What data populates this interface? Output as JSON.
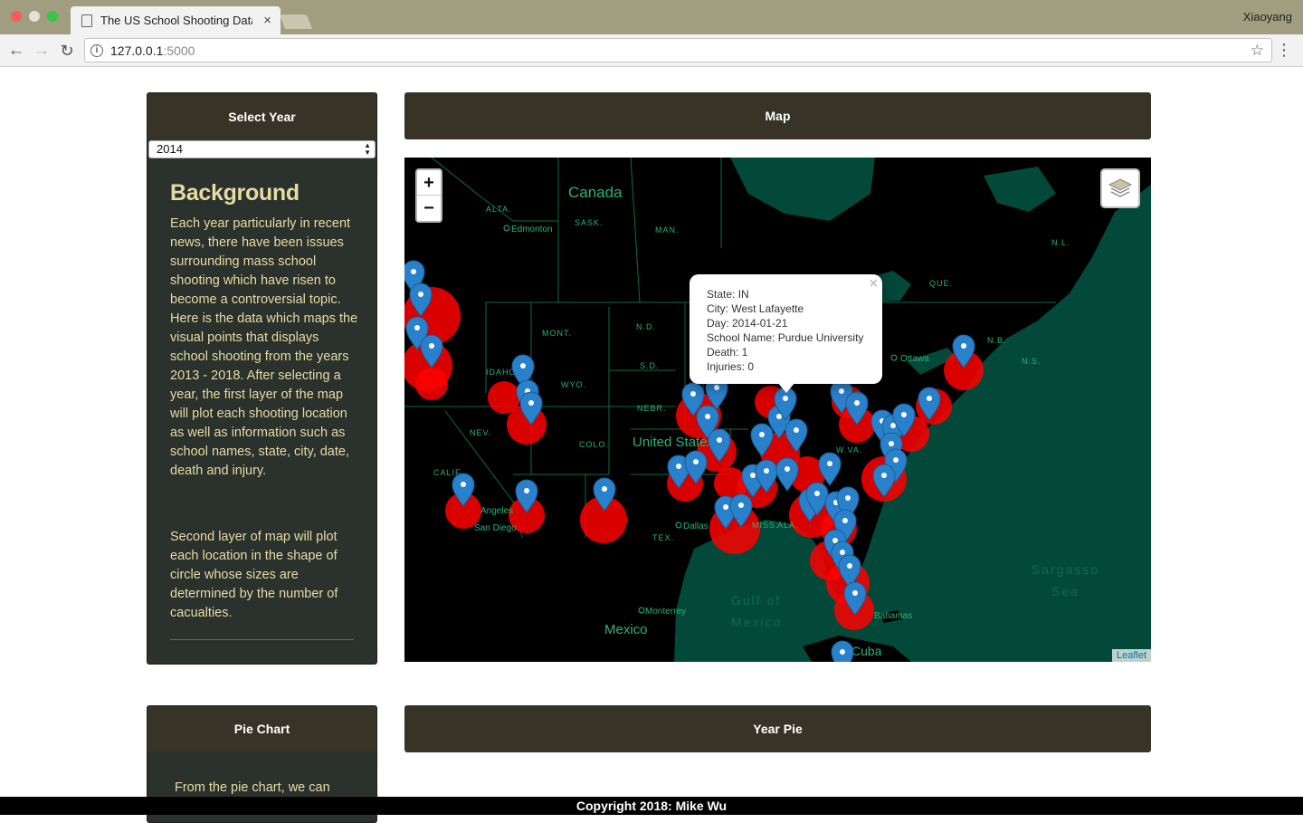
{
  "browser": {
    "tab_title": "The US School Shooting Data",
    "tab_close": "×",
    "profile_name": "Xiaoyang",
    "url_host": "127.0.0.1",
    "url_port": ":5000"
  },
  "sidebar": {
    "header": "Select Year",
    "selected_year": "2014",
    "background_title": "Background",
    "background_para1": "Each year particularly in recent news, there have been issues surrounding mass school shooting which have risen to become a controversial topic. Here is the data which maps the visual points that displays school shooting from the years 2013 - 2018. After selecting a year, the first layer of the map will plot each shooting location as well as information such as school names, state, city, date, death and injury.",
    "background_para2": "Second layer of map will plot each location in the shape of circle whose sizes are determined by the number of cacualties."
  },
  "map_panel": {
    "header": "Map",
    "zoom_in": "+",
    "zoom_out": "−",
    "attribution": "Leaflet",
    "labels": {
      "canada": "Canada",
      "alta": "ALTA.",
      "sask": "SASK.",
      "man": "MAN.",
      "edmonton": "Edmonton",
      "nl": "N.L.",
      "que": "QUE.",
      "ottawa": "Ottawa",
      "nb": "N.B.",
      "ns": "N.S.",
      "mont": "MONT.",
      "nd": "N.D.",
      "sd": "S.D.",
      "idaho": "IDAHO",
      "wyo": "WYO.",
      "nebr": "NEBR.",
      "nev": "NEV.",
      "colo": "COLO.",
      "calif": "CALIF.",
      "united_states": "United States",
      "angeles": "Angeles",
      "san_diego": "San Diego",
      "dallas": "Dallas",
      "tex": "TEX.",
      "miss": "MISS.",
      "ala": "ALA.",
      "wva": "W.VA.",
      "monterrey": "Monterrey",
      "mexico": "Mexico",
      "gulf1": "Gulf of",
      "gulf2": "Mexico",
      "bahamas": "Bahamas",
      "cuba": "Cuba",
      "sargasso1": "Sargasso",
      "sargasso2": "Sea"
    },
    "popup": {
      "state": "State: IN",
      "city": "City: West Lafayette",
      "day": "Day: 2014-01-21",
      "school": "School Name: Purdue University",
      "death": "Death: 1",
      "injuries": "Injuries: 0",
      "close": "×"
    }
  },
  "pie_panel": {
    "header": "Pie Chart",
    "text_start": "From the pie chart, we can"
  },
  "year_pie": {
    "header": "Year Pie"
  },
  "footer": {
    "copyright": "Copyright 2018: Mike Wu"
  },
  "colors": {
    "panel_header": "#373326",
    "panel_body": "#2b312c",
    "accent_text": "#e5dca4",
    "water": "#02493a",
    "land": "#000000",
    "circle": "#ff0000",
    "marker": "#2a81cb"
  }
}
